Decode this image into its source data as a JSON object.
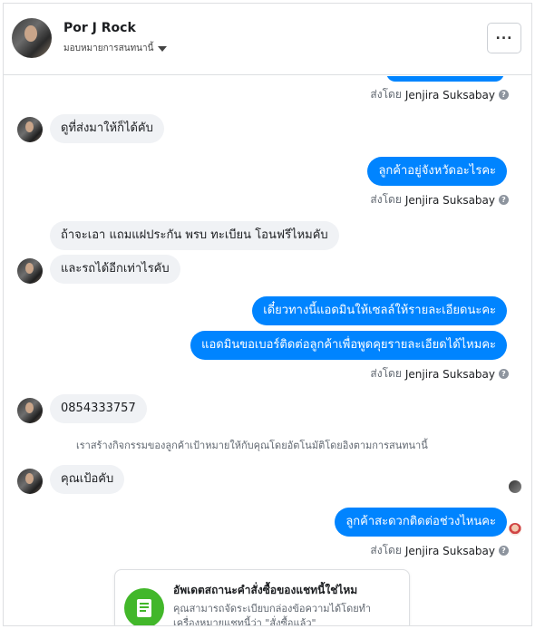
{
  "header": {
    "name": "Por J Rock",
    "subtitle": "มอบหมายการสนทนานี้",
    "more_label": "..."
  },
  "sent_by_prefix": "ส่งโดย",
  "sent_by_name": "Jenjira Suksabay",
  "messages": {
    "m1": "ดูที่ส่งมาให้ก็ได้คับ",
    "m2": "ลูกค้าอยู่จังหวัดอะไรคะ",
    "m3": "ถ้าจะเอา แถมแฝประกัน พรบ ทะเบียน โอนฟรีไหมคับ",
    "m4": "และรถได้อีกเท่าไรคับ",
    "m5": "เดี๋ยวทางนี้แอดมินให้เซลล์ให้รายละเอียดนะคะ",
    "m6": "แอดมินขอเบอร์ติดต่อลูกค้าเพื่อพูดคุยรายละเอียดได้ไหมคะ",
    "m7": "0854333757",
    "m8": "คุณเป้อคับ",
    "m9": "ลูกค้าสะดวกติดต่อช่วงไหนคะ"
  },
  "system_notice": "เราสร้างกิจกรรมของลูกค้าเป้าหมายให้กับคุณโดยอัตโนมัติโดยอิงตามการสนทนานี้",
  "card": {
    "title": "อัพเดตสถานะคำสั่งซื้อของแชทนี้ใช่ไหม",
    "body": "คุณสามารถจัดระเบียบกล่องข้อความได้โดยทำเครื่องหมายแชทนี้ว่า \"สั่งซื้อแล้ว\""
  },
  "colors": {
    "outgoing": "#0084ff",
    "incoming": "#f0f2f5",
    "card_icon": "#42b72a"
  },
  "icons": {
    "help": "question-circle-icon",
    "more": "more-dots-icon",
    "dropdown": "caret-down-icon",
    "card": "receipt-icon"
  }
}
